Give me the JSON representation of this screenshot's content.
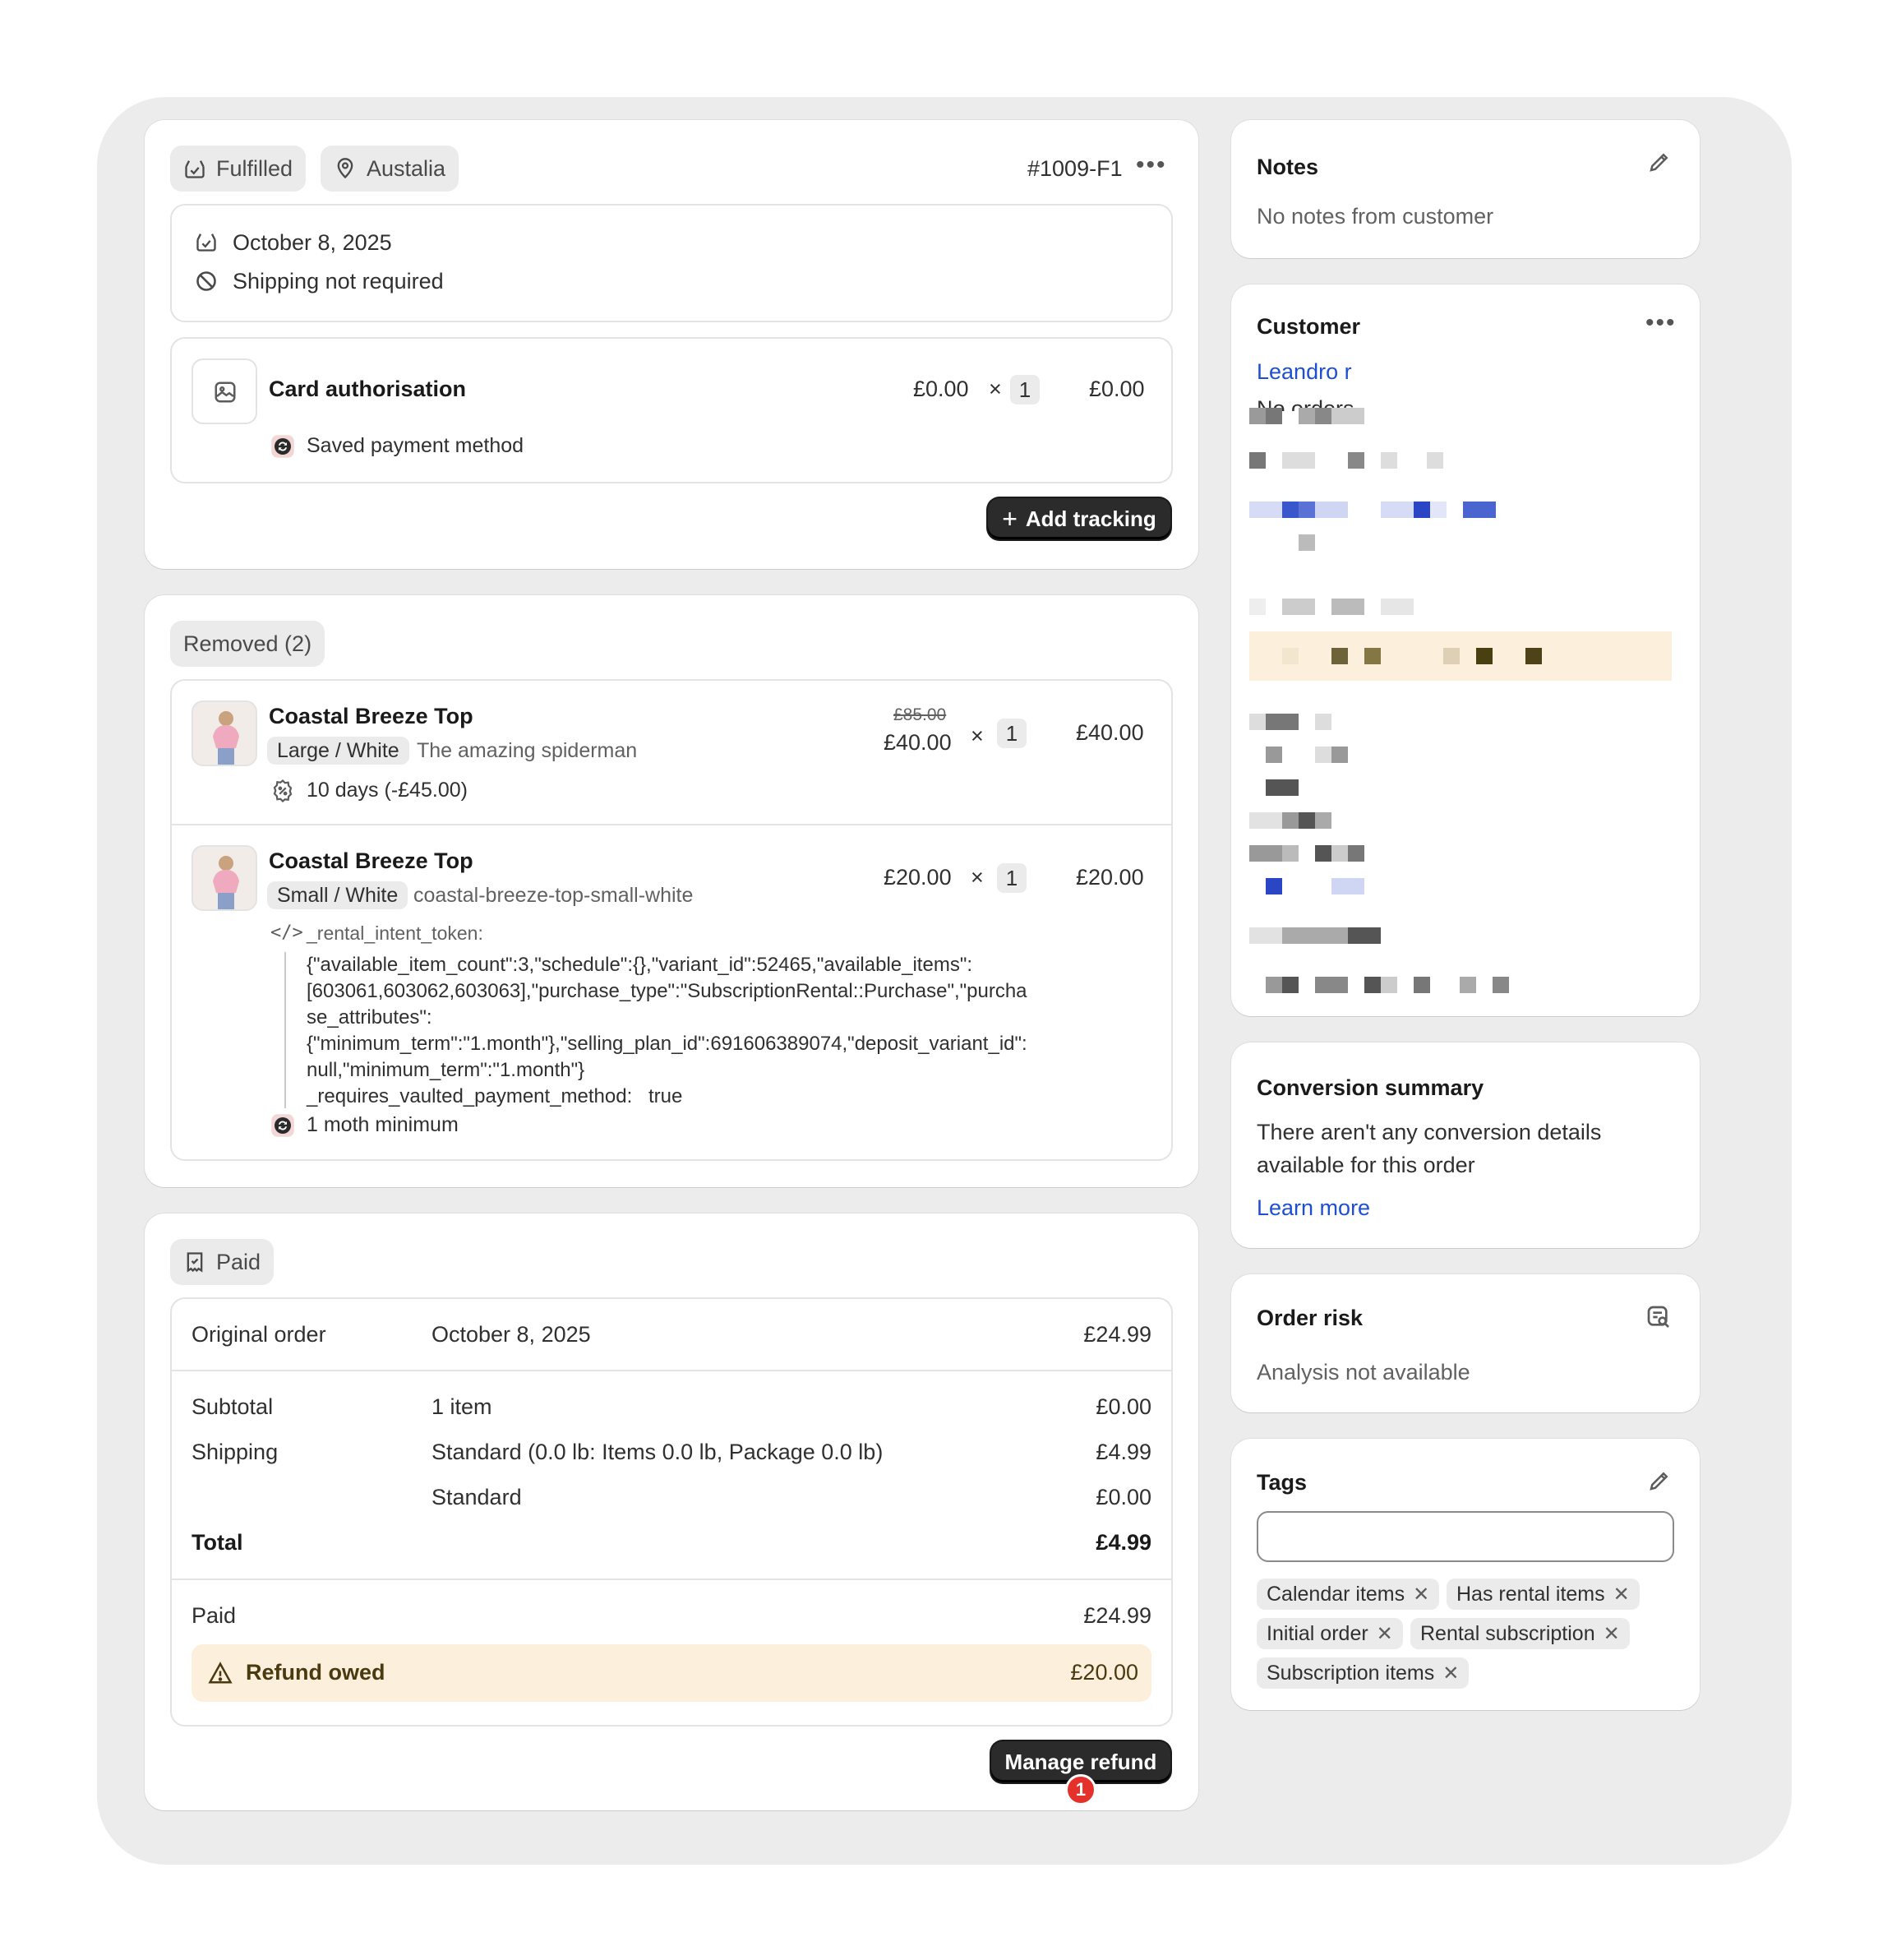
{
  "fulfillment": {
    "status": "Fulfilled",
    "location": "Austalia",
    "id": "#1009-F1",
    "date": "October 8, 2025",
    "shipping": "Shipping not required",
    "item_name": "Card authorisation",
    "item_price": "£0.00",
    "item_times": "×",
    "item_qty": "1",
    "item_total": "£0.00",
    "payment_method": "Saved payment method",
    "add_tracking": "Add tracking"
  },
  "removed": {
    "title": "Removed (2)",
    "items": [
      {
        "name": "Coastal Breeze Top",
        "variant": "Large / White",
        "sku": "The amazing spiderman",
        "old_price": "£85.00",
        "price": "£40.00",
        "times": "×",
        "qty": "1",
        "total": "£40.00",
        "discount": "10 days (-£45.00)"
      },
      {
        "name": "Coastal Breeze Top",
        "variant": "Small / White",
        "sku": "coastal-breeze-top-small-white",
        "price": "£20.00",
        "times": "×",
        "qty": "1",
        "total": "£20.00",
        "prop_key": "_rental_intent_token:",
        "prop_lines": [
          "{\"available_item_count\":3,\"schedule\":{},\"variant_id\":52465,\"available_items\":",
          "[603061,603062,603063],\"purchase_type\":\"SubscriptionRental::Purchase\",\"purcha",
          "se_attributes\":",
          "{\"minimum_term\":\"1.month\"},\"selling_plan_id\":691606389074,\"deposit_variant_id\":",
          "null,\"minimum_term\":\"1.month\"}"
        ],
        "prop2_key": "_requires_vaulted_payment_method:",
        "prop2_value": "true",
        "plan": "1 moth minimum"
      }
    ]
  },
  "payment": {
    "status": "Paid",
    "original_label": "Original order",
    "original_date": "October 8, 2025",
    "original_amount": "£24.99",
    "rows": [
      {
        "label": "Subtotal",
        "desc": "1 item",
        "amount": "£0.00"
      },
      {
        "label": "Shipping",
        "desc": "Standard (0.0 lb: Items 0.0 lb, Package 0.0 lb)",
        "amount": "£4.99"
      },
      {
        "label": "",
        "desc": "Standard",
        "amount": "£0.00"
      }
    ],
    "total_label": "Total",
    "total_amount": "£4.99",
    "paid_label": "Paid",
    "paid_amount": "£24.99",
    "refund_label": "Refund owed",
    "refund_amount": "£20.00",
    "manage_refund": "Manage refund",
    "badge": "1"
  },
  "notes": {
    "title": "Notes",
    "body": "No notes from customer"
  },
  "customer": {
    "title": "Customer",
    "name": "Leandro r",
    "orders": "No orders"
  },
  "conversion": {
    "title": "Conversion summary",
    "line1": "There aren't any conversion details",
    "line2": "available for this order",
    "learn_more": "Learn more"
  },
  "risk": {
    "title": "Order risk",
    "body": "Analysis not available"
  },
  "tags": {
    "title": "Tags",
    "items": [
      "Calendar items",
      "Has rental items",
      "Initial order",
      "Rental subscription",
      "Subscription items"
    ]
  },
  "colors": {
    "link": "#1f4fd1",
    "refund_bg": "#fcefdc",
    "badge": "#e5312b",
    "button": "#2b2b2b"
  }
}
